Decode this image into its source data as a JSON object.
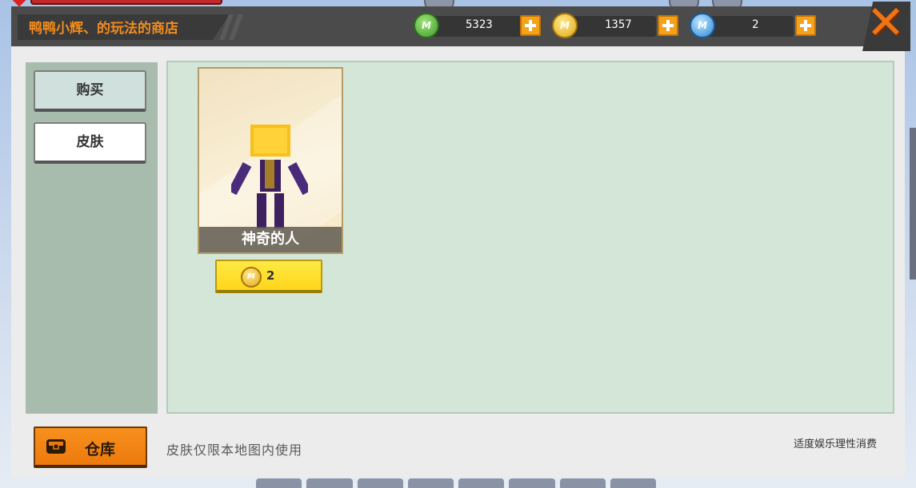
{
  "header": {
    "shop_title": "鸭鸭小辉、的玩法的商店"
  },
  "currencies": [
    {
      "name": "green-mini-coin",
      "amount": "5323",
      "color": "#4caf30"
    },
    {
      "name": "gold-mini-bean",
      "amount": "1357",
      "color": "#e2a91a"
    },
    {
      "name": "blue-mini-coin",
      "amount": "2",
      "color": "#2c86d6"
    }
  ],
  "sidebar": {
    "items": [
      {
        "label": "购买",
        "active": true
      },
      {
        "label": "皮肤",
        "active": false
      }
    ]
  },
  "items": [
    {
      "name": "神奇的人",
      "price": "2",
      "price_currency": "gold-mini-bean"
    }
  ],
  "footer": {
    "warehouse_label": "仓库",
    "note": "皮肤仅限本地图内使用",
    "disclaimer": "适度娱乐理性消费"
  },
  "icons": {
    "close": "close-icon",
    "add": "plus-icon",
    "warehouse": "chest-icon",
    "coin_letter": "M"
  },
  "colors": {
    "accent_orange": "#f28c1e",
    "header_bg": "#4b4b4b",
    "sidebar_bg": "#a8bcad",
    "content_bg": "#d3e6d8",
    "price_button": "#ffd61a"
  }
}
